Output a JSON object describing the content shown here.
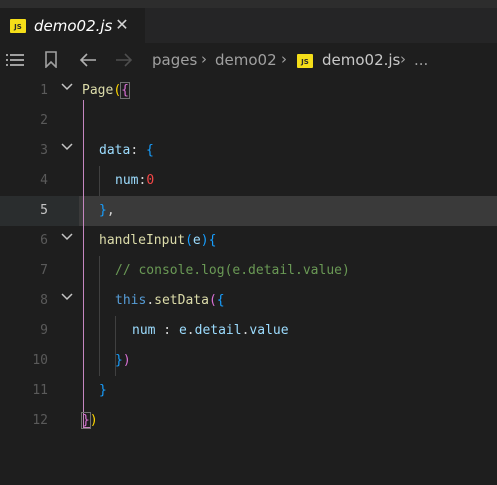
{
  "tab": {
    "badge": "JS",
    "label": "demo02.js",
    "close": "✕"
  },
  "breadcrumb": {
    "items": [
      "pages",
      "demo02",
      "demo02.js",
      "..."
    ],
    "file_badge": "JS",
    "separator": "›"
  },
  "editor": {
    "active_line": 5,
    "line_numbers": [
      "1",
      "2",
      "3",
      "4",
      "5",
      "6",
      "7",
      "8",
      "9",
      "10",
      "11",
      "12"
    ],
    "lines": {
      "l1": {
        "name": "Page",
        "open_paren": "(",
        "open_brace": "{"
      },
      "l3": {
        "key": "data",
        "colon": ": ",
        "brace": "{"
      },
      "l4": {
        "key": "num",
        "colon": ":",
        "value": "0"
      },
      "l5": {
        "brace": "}",
        "comma": ","
      },
      "l6": {
        "name": "handleInput",
        "open_paren": "(",
        "param": "e",
        "close_paren": ")",
        "brace": "{"
      },
      "l7": {
        "comment": "// console.log(e.detail.value)"
      },
      "l8": {
        "this": "this",
        "dot": ".",
        "method": "setData",
        "open_paren": "(",
        "brace": "{"
      },
      "l9": {
        "key": "num",
        "sep": " : ",
        "obj": "e",
        "dot1": ".",
        "prop1": "detail",
        "dot2": ".",
        "prop2": "value"
      },
      "l10": {
        "brace": "}",
        "close_paren": ")"
      },
      "l11": {
        "brace": "}"
      },
      "l12": {
        "brace": "}",
        "close_paren": ")"
      }
    }
  },
  "colors": {
    "background": "#1e1e1e",
    "tab_bar": "#252526",
    "current_line": "#3a3a3a",
    "js_badge": "#f5de19",
    "bracket_gold": "#ffd700",
    "bracket_purple": "#da70d6",
    "bracket_blue": "#179fff"
  }
}
